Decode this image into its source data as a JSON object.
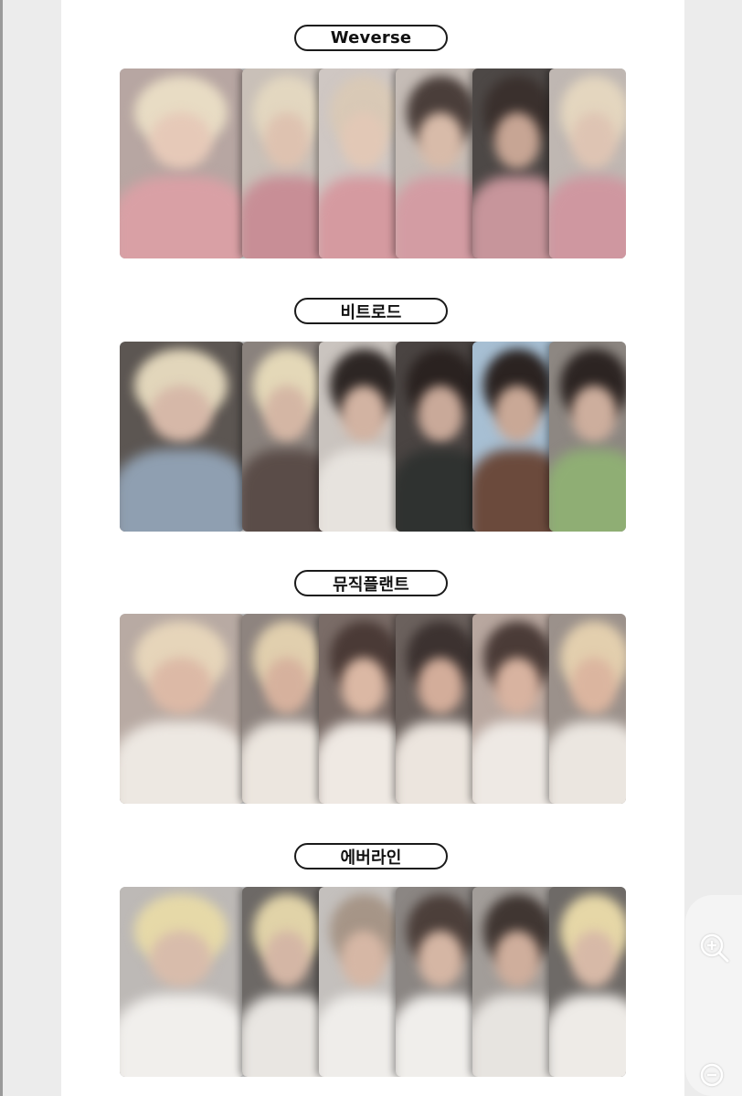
{
  "sections": [
    {
      "label": "Weverse",
      "card_colors": [
        {
          "bg": "#b7a6a2",
          "hair": "#e8dcc4",
          "face": "#e6c9b8",
          "body": "#d9a0a5"
        },
        {
          "bg": "#c9c0b8",
          "hair": "#e3d7c0",
          "face": "#dec2b0",
          "body": "#c88e96"
        },
        {
          "bg": "#cfc7c3",
          "hair": "#d9c9b6",
          "face": "#e2c8b6",
          "body": "#d59aa0"
        },
        {
          "bg": "#c5bcb6",
          "hair": "#4a3e3a",
          "face": "#d8bba9",
          "body": "#d39ca3"
        },
        {
          "bg": "#4d4846",
          "hair": "#3a302d",
          "face": "#c7a594",
          "body": "#c7959b"
        },
        {
          "bg": "#bfb7b2",
          "hair": "#e4d6bf",
          "face": "#dec4b3",
          "body": "#cf97a0"
        }
      ]
    },
    {
      "label": "비트로드",
      "card_colors": [
        {
          "bg": "#5c5652",
          "hair": "#e2d6bb",
          "face": "#d6b8a8",
          "body": "#8f9fb1"
        },
        {
          "bg": "#8a827d",
          "hair": "#e4d8b8",
          "face": "#d4b6a4",
          "body": "#5a4c48"
        },
        {
          "bg": "#cac4bf",
          "hair": "#2d2624",
          "face": "#d2b3a2",
          "body": "#e7e3de"
        },
        {
          "bg": "#4a4442",
          "hair": "#2a2220",
          "face": "#c9a999",
          "body": "#2f3230"
        },
        {
          "bg": "#a7bfd3",
          "hair": "#2b2321",
          "face": "#c9a896",
          "body": "#6b4a3c"
        },
        {
          "bg": "#8d8782",
          "hair": "#2c2422",
          "face": "#cdae9d",
          "body": "#8fae74"
        }
      ]
    },
    {
      "label": "뮤직플랜트",
      "card_colors": [
        {
          "bg": "#b8aaa3",
          "hair": "#e6d5ba",
          "face": "#dcb9a6",
          "body": "#ede8e2"
        },
        {
          "bg": "#8e847f",
          "hair": "#e1cfae",
          "face": "#d6b19d",
          "body": "#ece6df"
        },
        {
          "bg": "#7a6c67",
          "hair": "#4a3a36",
          "face": "#dbb8a4",
          "body": "#efe9e3"
        },
        {
          "bg": "#6b615d",
          "hair": "#3c3230",
          "face": "#d3ad9a",
          "body": "#ece5de"
        },
        {
          "bg": "#b8a79f",
          "hair": "#4a3b37",
          "face": "#d8b3a0",
          "body": "#eee9e4"
        },
        {
          "bg": "#9b918b",
          "hair": "#e3cfae",
          "face": "#dbb59f",
          "body": "#ebe6e0"
        }
      ]
    },
    {
      "label": "에버라인",
      "card_colors": [
        {
          "bg": "#bdb9b6",
          "hair": "#e6d9a8",
          "face": "#d8bcab",
          "body": "#f1efec"
        },
        {
          "bg": "#6d6966",
          "hair": "#e1d3a8",
          "face": "#d4b6a5",
          "body": "#e9e6e2"
        },
        {
          "bg": "#c4c0bd",
          "hair": "#a69587",
          "face": "#d6b7a5",
          "body": "#efedea"
        },
        {
          "bg": "#8b8683",
          "hair": "#4c3f3a",
          "face": "#d5b6a4",
          "body": "#f0eeeb"
        },
        {
          "bg": "#a29d99",
          "hair": "#403632",
          "face": "#cfae9c",
          "body": "#e7e4e0"
        },
        {
          "bg": "#6e6a67",
          "hair": "#e6d7a7",
          "face": "#d7b9a7",
          "body": "#eeebe7"
        }
      ]
    }
  ],
  "zoom": {
    "zoom_in_icon": "zoom-in-icon",
    "zoom_out_icon": "zoom-out-icon"
  }
}
